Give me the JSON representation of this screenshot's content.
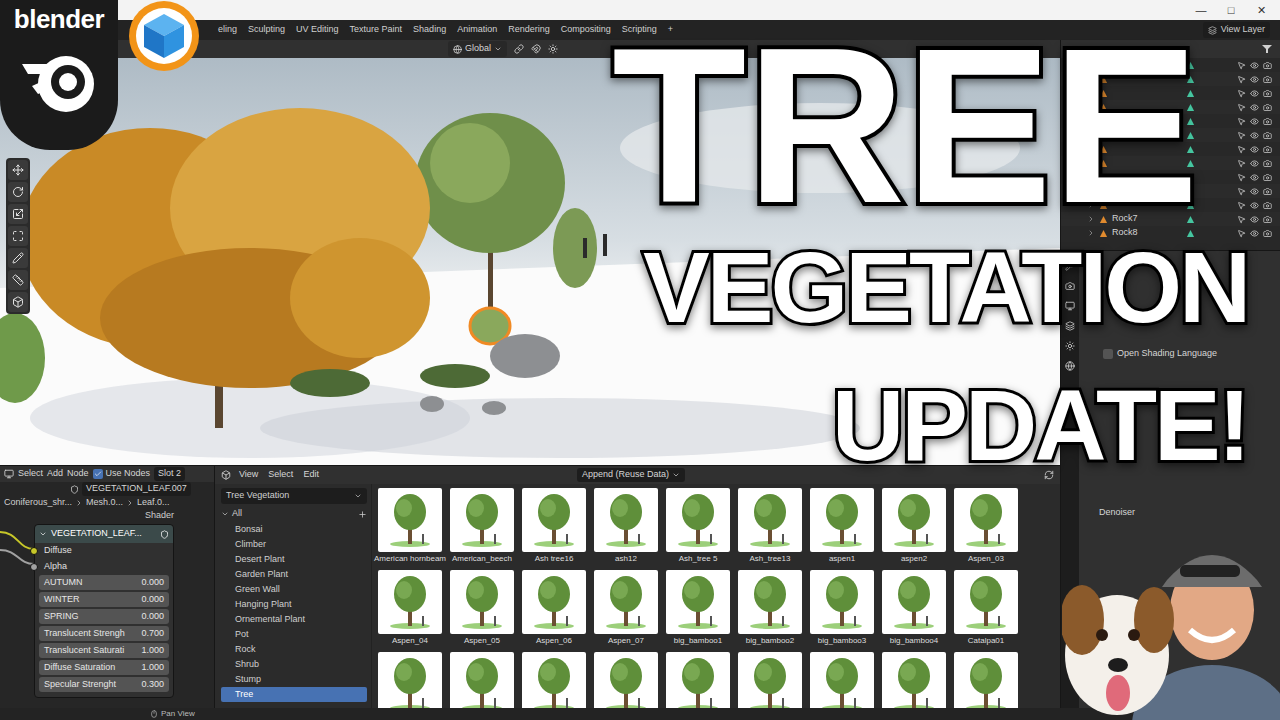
{
  "window": {
    "controls": [
      "—",
      "□",
      "✕"
    ]
  },
  "overlay": {
    "logo_text": "blender",
    "headline": [
      "TREE",
      "VEGETATION",
      "UPDATE!"
    ]
  },
  "topbar": {
    "workspaces": [
      {
        "label": "eling",
        "selected": false
      },
      {
        "label": "Sculpting",
        "selected": false
      },
      {
        "label": "UV Editing",
        "selected": false
      },
      {
        "label": "Texture Paint",
        "selected": false
      },
      {
        "label": "Shading",
        "selected": false
      },
      {
        "label": "Animation",
        "selected": false
      },
      {
        "label": "Rendering",
        "selected": false
      },
      {
        "label": "Compositing",
        "selected": false
      },
      {
        "label": "Scripting",
        "selected": false
      }
    ],
    "add": "+",
    "view_layer": "View Layer"
  },
  "viewport": {
    "orientation": "Global"
  },
  "outliner": {
    "rows": [
      {
        "name": "",
        "visible": true
      },
      {
        "name": "",
        "visible": true
      },
      {
        "name": "",
        "visible": true
      },
      {
        "name": "",
        "visible": true
      },
      {
        "name": "",
        "visible": true
      },
      {
        "name": "",
        "visible": true
      },
      {
        "name": "",
        "visible": true
      },
      {
        "name": "",
        "visible": true
      },
      {
        "name": "",
        "visible": true
      },
      {
        "name": "",
        "visible": true
      },
      {
        "name": "",
        "visible": true
      },
      {
        "name": "Rock7",
        "visible": true
      },
      {
        "name": "Rock8",
        "visible": true
      }
    ]
  },
  "properties": {
    "checkboxes": [
      {
        "label": "Open Shading Language",
        "checked": false
      }
    ],
    "denoiser_label": "Denoiser"
  },
  "node_editor": {
    "menus": [
      "Select",
      "Add",
      "Node"
    ],
    "use_nodes": {
      "label": "Use Nodes",
      "checked": true
    },
    "slot": "Slot 2",
    "material": "VEGETATION_LEAF.007",
    "breadcrumbs": [
      "Coniferous_shr...",
      "Mesh.0...",
      "Leaf.0..."
    ],
    "tree_type": "Shader",
    "node": {
      "title": "VEGETATION_LEAF...",
      "inputs": [
        {
          "name": "Diffuse",
          "color": "#c7c729"
        },
        {
          "name": "Alpha",
          "color": "#a1a1a1"
        }
      ],
      "fields": [
        {
          "label": "AUTUMN",
          "value": "0.000"
        },
        {
          "label": "WINTER",
          "value": "0.000"
        },
        {
          "label": "SPRING",
          "value": "0.000"
        },
        {
          "label": "Translucent Strengh",
          "value": "0.700"
        },
        {
          "label": "Translucent Saturati",
          "value": "1.000"
        },
        {
          "label": "Diffuse Saturation",
          "value": "1.000"
        },
        {
          "label": "Specular Strenght",
          "value": "0.300"
        }
      ]
    }
  },
  "asset_browser": {
    "menus": [
      "View",
      "Select",
      "Edit"
    ],
    "import_method": "Append (Reuse Data)",
    "library": "Tree Vegetation",
    "catalog_root": {
      "label": "All",
      "expanded": true
    },
    "catalogs": [
      {
        "label": "Bonsai",
        "selected": false
      },
      {
        "label": "Climber",
        "selected": false
      },
      {
        "label": "Desert Plant",
        "selected": false
      },
      {
        "label": "Garden Plant",
        "selected": false
      },
      {
        "label": "Green Wall",
        "selected": false
      },
      {
        "label": "Hanging Plant",
        "selected": false
      },
      {
        "label": "Ornemental Plant",
        "selected": false
      },
      {
        "label": "Pot",
        "selected": false
      },
      {
        "label": "Rock",
        "selected": false
      },
      {
        "label": "Shrub",
        "selected": false
      },
      {
        "label": "Stump",
        "selected": false
      },
      {
        "label": "Tree",
        "selected": true
      }
    ],
    "assets": [
      {
        "name": "American hornbeam"
      },
      {
        "name": "American_beech"
      },
      {
        "name": "Ash tree16"
      },
      {
        "name": "ash12"
      },
      {
        "name": "Ash_tree 5"
      },
      {
        "name": "Ash_tree13"
      },
      {
        "name": "aspen1"
      },
      {
        "name": "aspen2"
      },
      {
        "name": "Aspen_03"
      },
      {
        "name": "Aspen_04"
      },
      {
        "name": "Aspen_05"
      },
      {
        "name": "Aspen_06"
      },
      {
        "name": "Aspen_07"
      },
      {
        "name": "big_bamboo1"
      },
      {
        "name": "big_bamboo2"
      },
      {
        "name": "big_bamboo3"
      },
      {
        "name": "big_bamboo4"
      },
      {
        "name": "Catalpa01"
      },
      {
        "name": null
      },
      {
        "name": null
      },
      {
        "name": null
      },
      {
        "name": null
      },
      {
        "name": null
      },
      {
        "name": null
      },
      {
        "name": null
      },
      {
        "name": null
      },
      {
        "name": null
      }
    ]
  },
  "status_bar": {
    "hint": "Pan View"
  }
}
